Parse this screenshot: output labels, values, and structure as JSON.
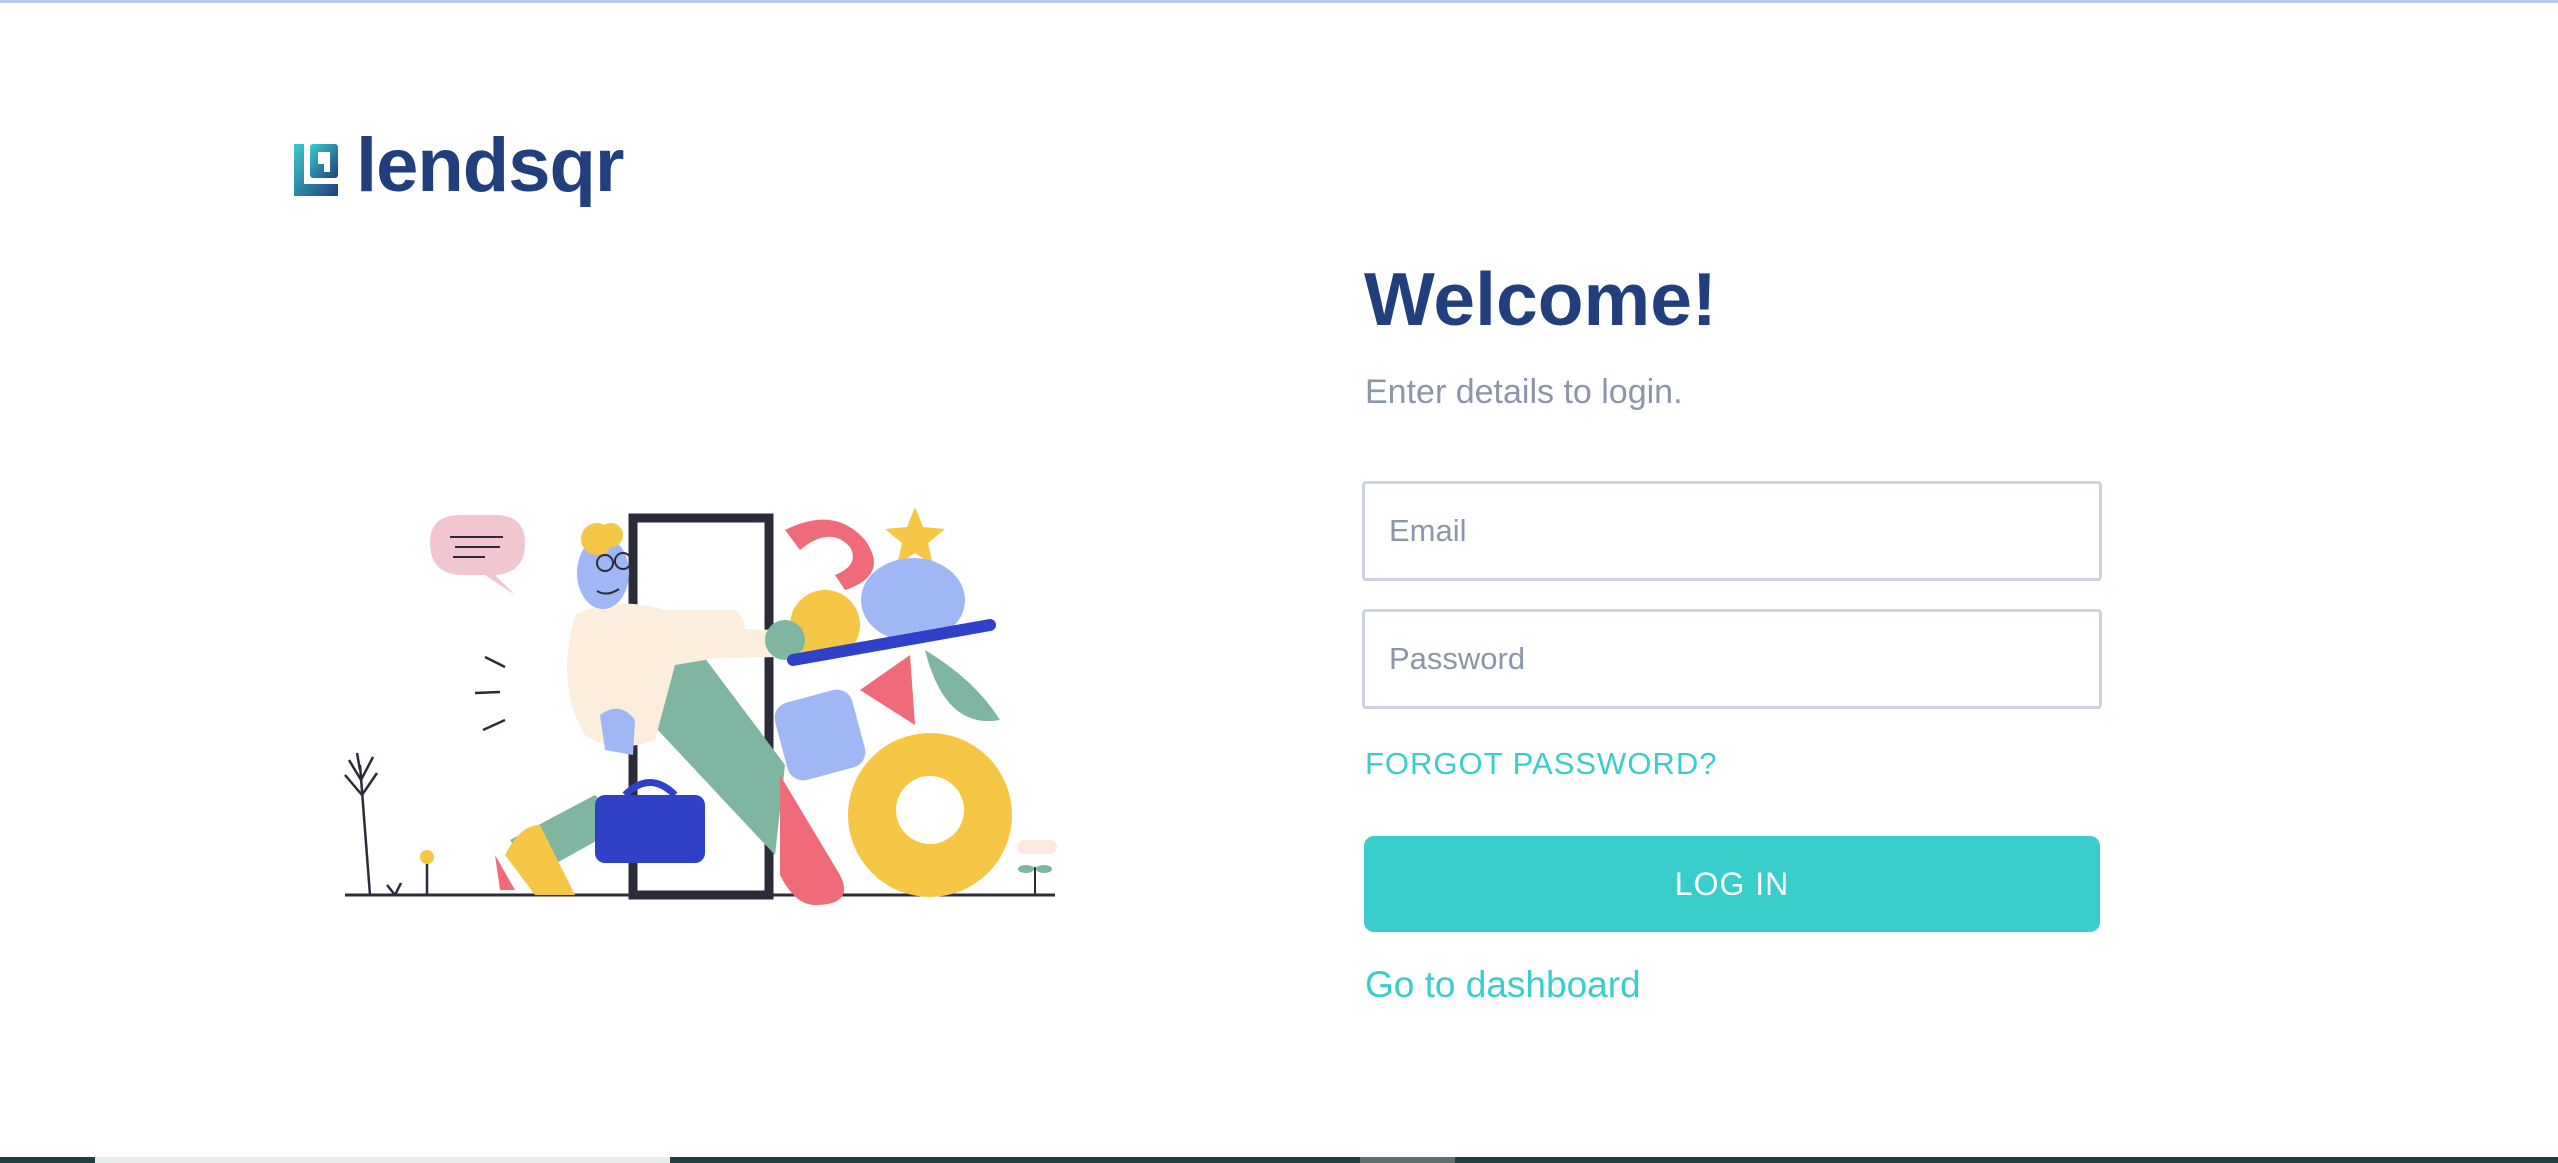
{
  "brand": {
    "name": "lendsqr",
    "logo_icon": "lendsqr-logo-mark-icon",
    "primary_color": "#213f7d",
    "accent_color": "#39cdcc",
    "muted_text_color": "#8a96aa"
  },
  "illustration": {
    "icon": "sign-in-illustration"
  },
  "login": {
    "title": "Welcome!",
    "subtitle": "Enter details to login.",
    "email": {
      "placeholder": "Email",
      "value": ""
    },
    "password": {
      "placeholder": "Password",
      "value": ""
    },
    "forgot_password_label": "FORGOT PASSWORD?",
    "login_button_label": "LOG IN",
    "dashboard_link_label": "Go to dashboard"
  }
}
